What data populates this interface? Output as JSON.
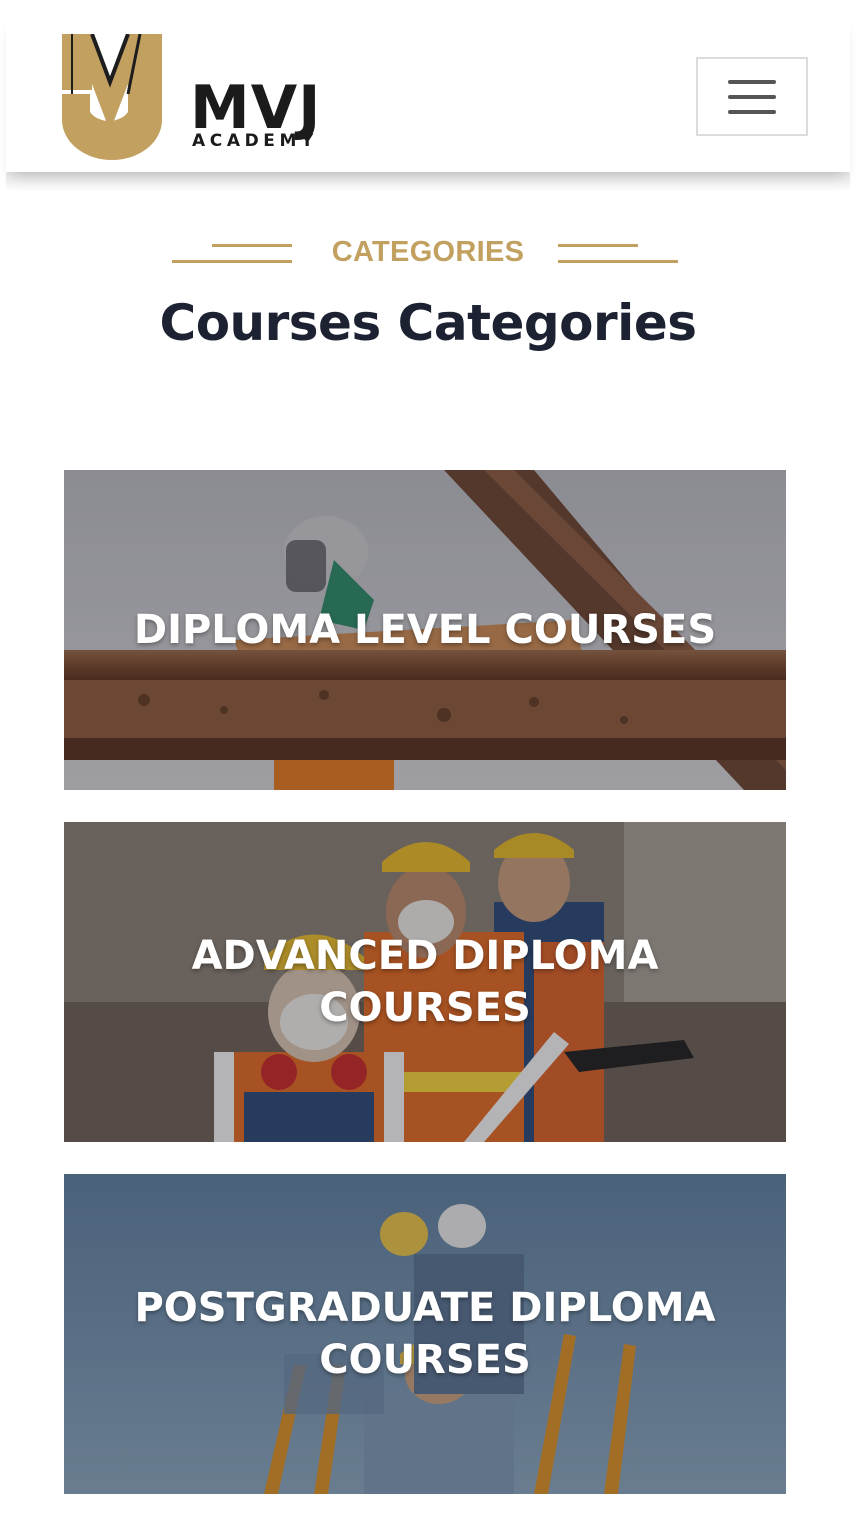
{
  "brand": {
    "name": "MVJ",
    "subtitle": "ACADEMY",
    "colors": {
      "gold": "#c2a060",
      "dark": "#1d2233"
    }
  },
  "header": {
    "menu_icon": "hamburger-menu-icon"
  },
  "section": {
    "eyebrow": "CATEGORIES",
    "title": "Courses Categories"
  },
  "categories": [
    {
      "label": "DIPLOMA LEVEL COURSES"
    },
    {
      "label": "ADVANCED DIPLOMA COURSES"
    },
    {
      "label": "POSTGRADUATE DIPLOMA COURSES"
    }
  ]
}
